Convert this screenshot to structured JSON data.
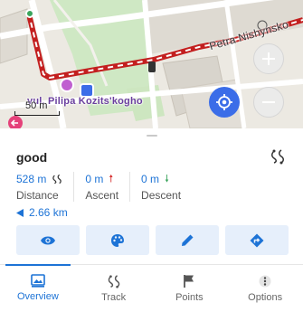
{
  "map": {
    "street_top": "Petra Nishynsko",
    "street_bottom": "vul. Pilipa Kozits'kogho",
    "scale_label": "50 m",
    "colors": {
      "route": "#e03030",
      "park": "#cfe8c4",
      "locate": "#3b6de8"
    }
  },
  "track": {
    "name": "good",
    "stats": [
      {
        "value": "528 m",
        "label": "Distance",
        "icon": "track-icon"
      },
      {
        "value": "0 m",
        "label": "Ascent",
        "icon": "arrow-up-icon"
      },
      {
        "value": "0 m",
        "label": "Descent",
        "icon": "arrow-down-icon"
      }
    ],
    "distance_back": "2.66 km",
    "actions": [
      "view",
      "appearance",
      "edit",
      "navigate"
    ]
  },
  "tabs": [
    {
      "label": "Overview",
      "icon": "overview-icon",
      "active": true
    },
    {
      "label": "Track",
      "icon": "track-icon",
      "active": false
    },
    {
      "label": "Points",
      "icon": "flag-icon",
      "active": false
    },
    {
      "label": "Options",
      "icon": "more-icon",
      "active": false
    }
  ]
}
